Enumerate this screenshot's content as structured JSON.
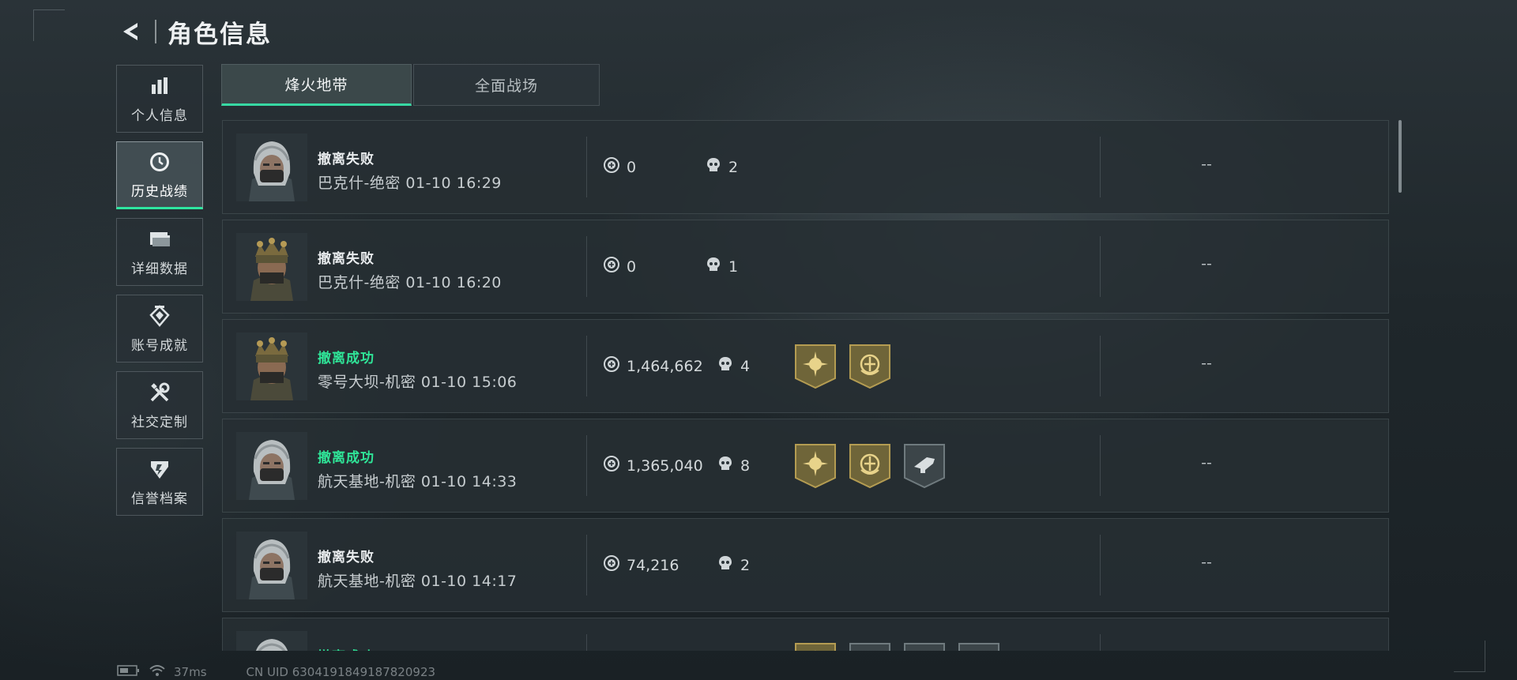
{
  "header": {
    "title": "角色信息",
    "back_icon": "back-arrow-icon"
  },
  "sidebar": {
    "items": [
      {
        "label": "个人信息",
        "icon": "bar-chart-icon",
        "active": false
      },
      {
        "label": "历史战绩",
        "icon": "clock-icon",
        "active": true
      },
      {
        "label": "详细数据",
        "icon": "folder-icon",
        "active": false
      },
      {
        "label": "账号成就",
        "icon": "medal-icon",
        "active": false
      },
      {
        "label": "社交定制",
        "icon": "tools-icon",
        "active": false
      },
      {
        "label": "信誉档案",
        "icon": "shield-icon",
        "active": false
      }
    ]
  },
  "tabs": [
    {
      "label": "烽火地带",
      "active": true
    },
    {
      "label": "全面战场",
      "active": false
    }
  ],
  "matches": [
    {
      "result": "撤离失败",
      "success": false,
      "map": "巴克什-绝密 01-10 16:29",
      "value": "0",
      "kills": "2",
      "badges": [],
      "extra": "--",
      "avatar": "operator-hooded-avatar"
    },
    {
      "result": "撤离失败",
      "success": false,
      "map": "巴克什-绝密 01-10 16:20",
      "value": "0",
      "kills": "1",
      "badges": [],
      "extra": "--",
      "avatar": "operator-crown-avatar"
    },
    {
      "result": "撤离成功",
      "success": true,
      "map": "零号大坝-机密 01-10 15:06",
      "value": "1,464,662",
      "kills": "4",
      "badges": [
        "gold-sun-badge",
        "gold-emblem-badge"
      ],
      "extra": "--",
      "avatar": "operator-crown-avatar"
    },
    {
      "result": "撤离成功",
      "success": true,
      "map": "航天基地-机密 01-10 14:33",
      "value": "1,365,040",
      "kills": "8",
      "badges": [
        "gold-sun-badge",
        "gold-emblem-badge",
        "gray-weapon-badge"
      ],
      "extra": "--",
      "avatar": "operator-hooded-avatar"
    },
    {
      "result": "撤离失败",
      "success": false,
      "map": "航天基地-机密 01-10 14:17",
      "value": "74,216",
      "kills": "2",
      "badges": [],
      "extra": "--",
      "avatar": "operator-hooded-avatar"
    },
    {
      "result": "撤离成功",
      "success": true,
      "map": "",
      "value": "",
      "kills": "",
      "badges": [
        "gold-sun-badge",
        "gray-badge",
        "gray-badge",
        "gray-badge"
      ],
      "extra": "",
      "avatar": "operator-hooded-avatar"
    }
  ],
  "footer": {
    "ping": "37ms",
    "uid": "CN UID 6304191849187820923"
  },
  "colors": {
    "accent": "#2fe598",
    "gold": "#a8924d",
    "panel": "#262e33"
  }
}
